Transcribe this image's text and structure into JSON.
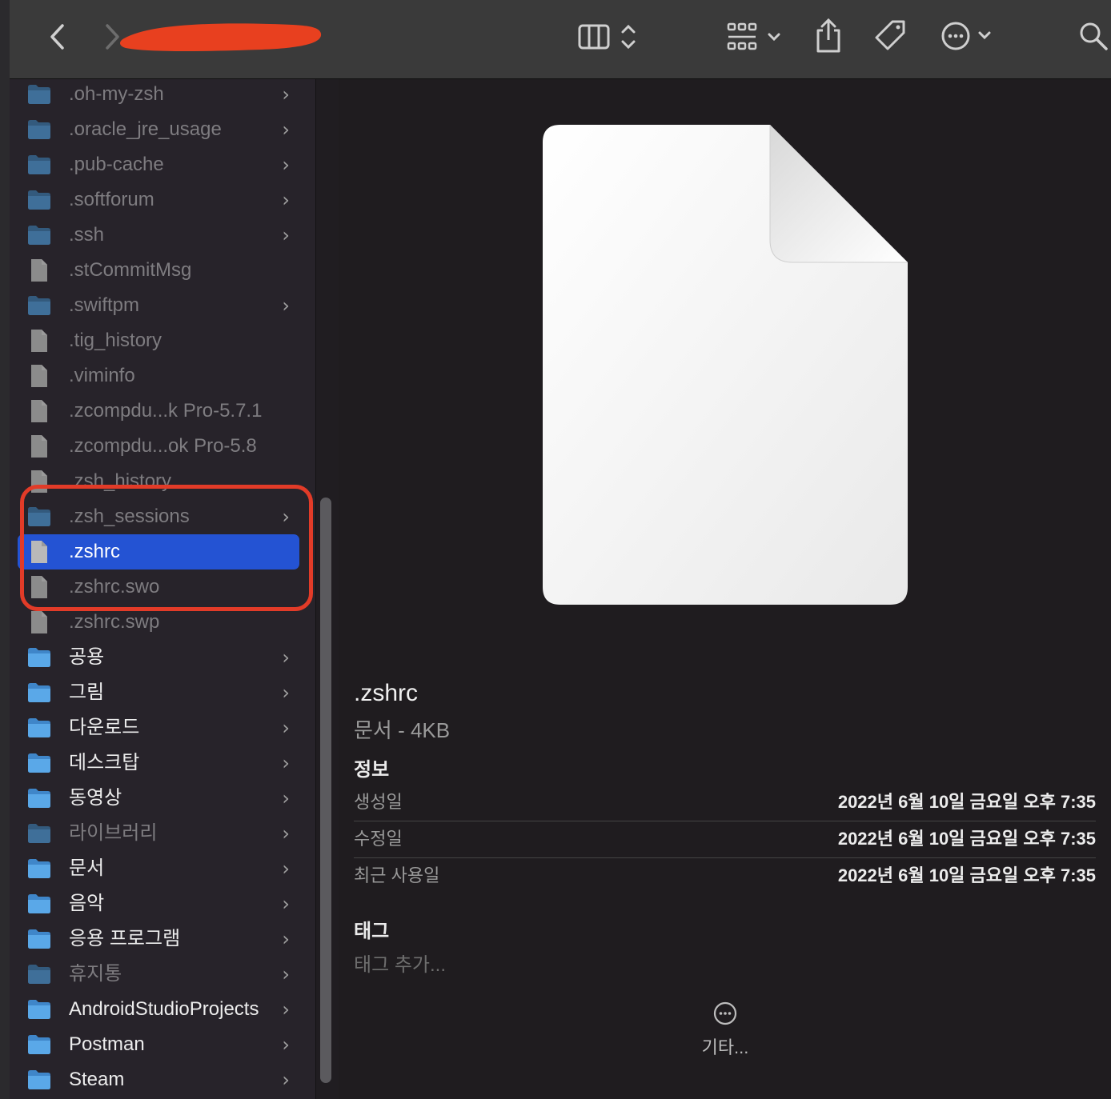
{
  "toolbar": {
    "back_icon": "chevron-left-icon",
    "forward_icon": "chevron-right-icon",
    "view_icon": "column-view-icon",
    "group_icon": "grid-group-icon",
    "share_icon": "share-icon",
    "tag_icon": "tag-icon",
    "action_icon": "ellipsis-circle-icon",
    "search_icon": "search-icon"
  },
  "sidebar": {
    "items": [
      {
        "label": ".oh-my-zsh",
        "kind": "folder",
        "chevron": "›"
      },
      {
        "label": ".oracle_jre_usage",
        "kind": "folder",
        "chevron": "›"
      },
      {
        "label": ".pub-cache",
        "kind": "folder",
        "chevron": "›"
      },
      {
        "label": ".softforum",
        "kind": "folder",
        "chevron": "›"
      },
      {
        "label": ".ssh",
        "kind": "folder",
        "chevron": "›"
      },
      {
        "label": ".stCommitMsg",
        "kind": "file"
      },
      {
        "label": ".swiftpm",
        "kind": "folder",
        "chevron": "›"
      },
      {
        "label": ".tig_history",
        "kind": "file"
      },
      {
        "label": ".viminfo",
        "kind": "file"
      },
      {
        "label": ".zcompdu...k Pro-5.7.1",
        "kind": "file"
      },
      {
        "label": ".zcompdu...ok Pro-5.8",
        "kind": "file"
      },
      {
        "label": ".zsh_history",
        "kind": "file"
      },
      {
        "label": ".zsh_sessions",
        "kind": "folder",
        "chevron": "›"
      },
      {
        "label": ".zshrc",
        "kind": "file",
        "selected": true
      },
      {
        "label": ".zshrc.swo",
        "kind": "file"
      },
      {
        "label": ".zshrc.swp",
        "kind": "file"
      },
      {
        "label": "공용",
        "kind": "folder",
        "chevron": "›",
        "bright": true
      },
      {
        "label": "그림",
        "kind": "folder",
        "chevron": "›",
        "bright": true
      },
      {
        "label": "다운로드",
        "kind": "folder",
        "chevron": "›",
        "bright": true
      },
      {
        "label": "데스크탑",
        "kind": "folder",
        "chevron": "›",
        "bright": true
      },
      {
        "label": "동영상",
        "kind": "folder",
        "chevron": "›",
        "bright": true
      },
      {
        "label": "라이브러리",
        "kind": "folder",
        "chevron": "›"
      },
      {
        "label": "문서",
        "kind": "folder",
        "chevron": "›",
        "bright": true
      },
      {
        "label": "음악",
        "kind": "folder",
        "chevron": "›",
        "bright": true
      },
      {
        "label": "응용 프로그램",
        "kind": "folder",
        "chevron": "›",
        "bright": true
      },
      {
        "label": "휴지통",
        "kind": "folder",
        "chevron": "›"
      },
      {
        "label": "AndroidStudioProjects",
        "kind": "folder",
        "chevron": "›",
        "bright": true
      },
      {
        "label": "Postman",
        "kind": "folder",
        "chevron": "›",
        "bright": true
      },
      {
        "label": "Steam",
        "kind": "folder",
        "chevron": "›",
        "bright": true
      }
    ]
  },
  "preview": {
    "file_name": ".zshrc",
    "file_kind": "문서 - 4KB",
    "info_heading": "정보",
    "info": [
      {
        "label": "생성일",
        "value": "2022년 6월 10일 금요일 오후 7:35"
      },
      {
        "label": "수정일",
        "value": "2022년 6월 10일 금요일 오후 7:35"
      },
      {
        "label": "최근 사용일",
        "value": "2022년 6월 10일 금요일 오후 7:35"
      }
    ],
    "tags_heading": "태그",
    "tags_placeholder": "태그 추가...",
    "more_label": "기타..."
  },
  "colors": {
    "selection": "#2453d3",
    "highlight_outline": "#e23b28",
    "folder": "#5aa8e8"
  }
}
